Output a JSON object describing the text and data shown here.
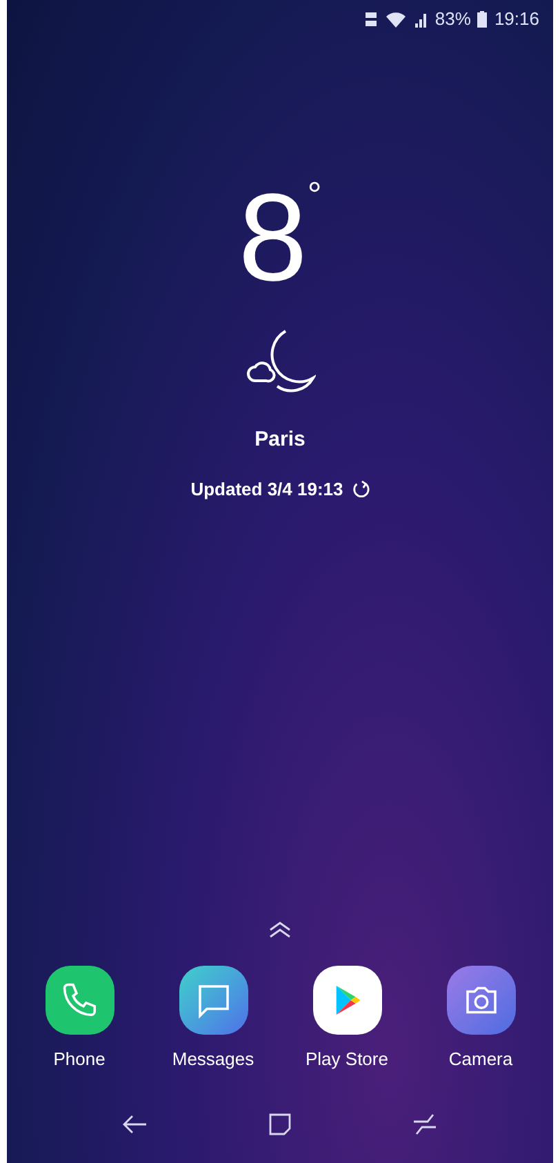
{
  "status_bar": {
    "battery": "83%",
    "time": "19:16"
  },
  "weather": {
    "temperature": "8",
    "unit": "°",
    "city": "Paris",
    "updated": "Updated 3/4 19:13"
  },
  "dock": [
    {
      "label": "Phone",
      "kind": "phone"
    },
    {
      "label": "Messages",
      "kind": "messages"
    },
    {
      "label": "Play Store",
      "kind": "store"
    },
    {
      "label": "Camera",
      "kind": "camera"
    }
  ]
}
